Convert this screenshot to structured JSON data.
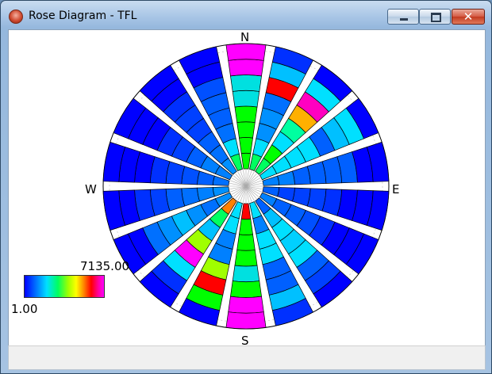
{
  "window": {
    "title": "Rose Diagram - TFL",
    "icon": "app-icon",
    "buttons": {
      "minimize": "minimize-icon",
      "maximize": "maximize-icon",
      "close": "✕"
    }
  },
  "compass": {
    "north": "N",
    "south": "S",
    "east": "E",
    "west": "W"
  },
  "legend": {
    "max": "7135.00",
    "min": "1.00"
  },
  "colors": {
    "scale": [
      "#0000ff",
      "#0060ff",
      "#00e0ff",
      "#00ff60",
      "#a0ff00",
      "#ffff00",
      "#ff8000",
      "#ff0000",
      "#ff00ff"
    ]
  },
  "chart_data": {
    "type": "rose",
    "sectors": 18,
    "sector_width_deg": 16,
    "rings": 8,
    "value_range": [
      1.0,
      7135.0
    ],
    "wedges": [
      {
        "bearing": 0,
        "colors": [
          "#00ff00",
          "#00ff00",
          "#00ff00",
          "#00ff00",
          "#00e0e0",
          "#00e0e0",
          "#ff00ff",
          "#ff00ff"
        ]
      },
      {
        "bearing": 20,
        "colors": [
          "#00ff60",
          "#00e0ff",
          "#0090ff",
          "#0090ff",
          "#0070ff",
          "#ff0000",
          "#00c0ff",
          "#0030ff"
        ]
      },
      {
        "bearing": 40,
        "colors": [
          "#00ff60",
          "#00ff00",
          "#00e0ff",
          "#00ffa0",
          "#ffb000",
          "#ff00c0",
          "#00e0ff",
          "#0000ff"
        ]
      },
      {
        "bearing": 60,
        "colors": [
          "#00e0ff",
          "#00e0ff",
          "#00e0ff",
          "#00e0ff",
          "#0060ff",
          "#00c0ff",
          "#00e0ff",
          "#0000ff"
        ]
      },
      {
        "bearing": 80,
        "colors": [
          "#0080ff",
          "#0080ff",
          "#0060ff",
          "#0060ff",
          "#0060ff",
          "#0060ff",
          "#0000ff",
          "#0000ff"
        ]
      },
      {
        "bearing": 100,
        "colors": [
          "#0060ff",
          "#0040ff",
          "#0040ff",
          "#0040ff",
          "#0030ff",
          "#0000ff",
          "#0000ff",
          "#0000ff"
        ]
      },
      {
        "bearing": 120,
        "colors": [
          "#0080ff",
          "#0060ff",
          "#0060ff",
          "#0050ff",
          "#0030ff",
          "#0000ff",
          "#0000ff",
          "#0000ff"
        ]
      },
      {
        "bearing": 140,
        "colors": [
          "#0060ff",
          "#00c0ff",
          "#00e0ff",
          "#00d0ff",
          "#00e0ff",
          "#0060ff",
          "#0040ff",
          "#0000ff"
        ]
      },
      {
        "bearing": 160,
        "colors": [
          "#00e0ff",
          "#0080ff",
          "#00e0ff",
          "#00e0ff",
          "#0060ff",
          "#0060ff",
          "#00c0ff",
          "#0030ff"
        ]
      },
      {
        "bearing": 180,
        "colors": [
          "#ff0000",
          "#00ff00",
          "#00ff00",
          "#00ff00",
          "#00e0e0",
          "#00ff00",
          "#ff00ff",
          "#ff00ff"
        ]
      },
      {
        "bearing": 200,
        "colors": [
          "#00e0ff",
          "#00e0ff",
          "#0080ff",
          "#0080ff",
          "#a0ff00",
          "#ff0000",
          "#00ff00",
          "#0000ff"
        ]
      },
      {
        "bearing": 220,
        "colors": [
          "#ff8000",
          "#00ff60",
          "#00c0ff",
          "#a0ff00",
          "#ff00ff",
          "#00e0ff",
          "#0030ff",
          "#0000ff"
        ]
      },
      {
        "bearing": 240,
        "colors": [
          "#0090ff",
          "#0070ff",
          "#0090ff",
          "#00c0ff",
          "#0090ff",
          "#0070ff",
          "#0000ff",
          "#0000ff"
        ]
      },
      {
        "bearing": 260,
        "colors": [
          "#0090ff",
          "#0080ff",
          "#0070ff",
          "#0060ff",
          "#0040ff",
          "#0030ff",
          "#0000ff",
          "#0000ff"
        ]
      },
      {
        "bearing": 280,
        "colors": [
          "#0070ff",
          "#0060ff",
          "#0050ff",
          "#0040ff",
          "#0030ff",
          "#0000ff",
          "#0000ff",
          "#0000ff"
        ]
      },
      {
        "bearing": 300,
        "colors": [
          "#0080ff",
          "#0080ff",
          "#0060ff",
          "#0040ff",
          "#0030ff",
          "#0000ff",
          "#0000ff",
          "#0000ff"
        ]
      },
      {
        "bearing": 320,
        "colors": [
          "#0090ff",
          "#0070ff",
          "#0060ff",
          "#0040ff",
          "#0040ff",
          "#0030ff",
          "#0000ff",
          "#0000ff"
        ]
      },
      {
        "bearing": 340,
        "colors": [
          "#00ff60",
          "#00e0ff",
          "#0070ff",
          "#0060ff",
          "#0060ff",
          "#0050ff",
          "#0000ff",
          "#0000ff"
        ]
      }
    ]
  }
}
